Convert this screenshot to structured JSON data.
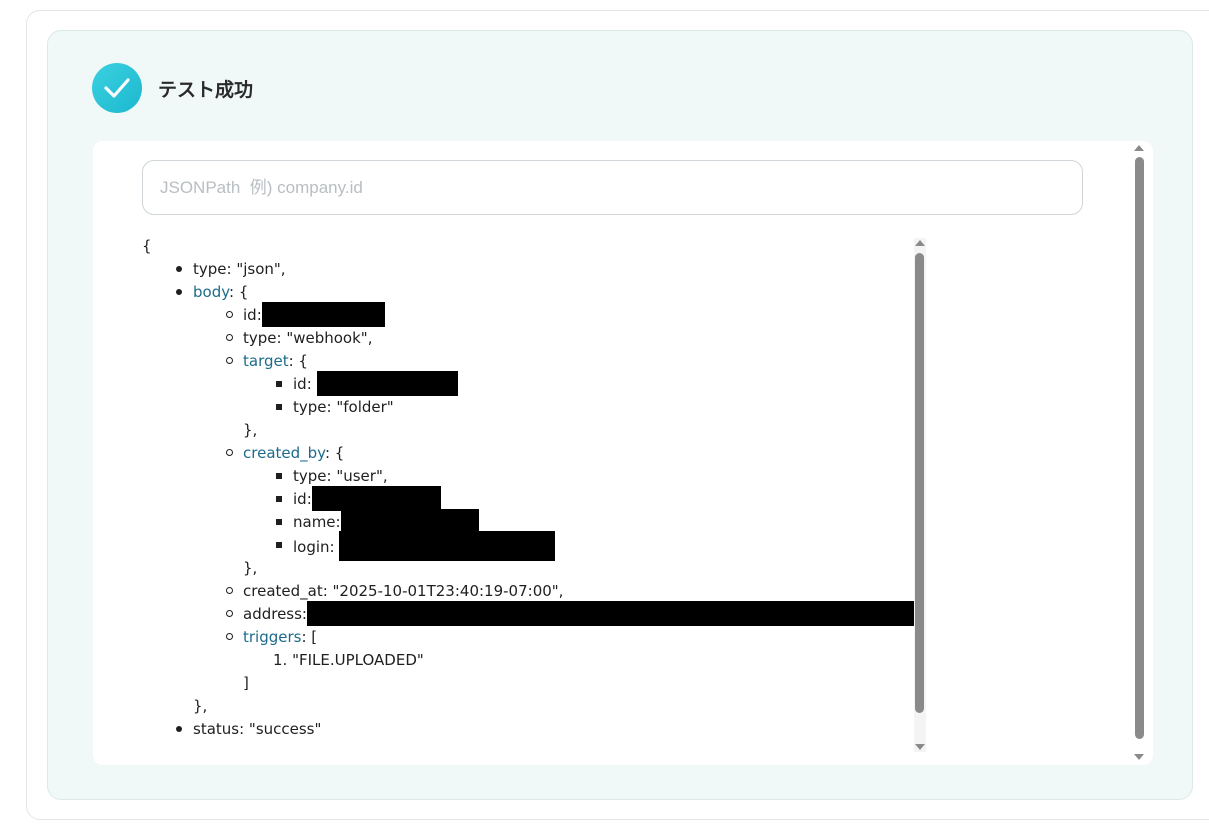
{
  "header": {
    "status_title": "テスト成功",
    "icon": "check-circle-icon",
    "accent_color": "#22c0d4"
  },
  "search": {
    "placeholder": "JSONPath  例) company.id",
    "value": ""
  },
  "tree": {
    "open_brace": "{",
    "type_line": "type: \"json\",",
    "body_key": "body",
    "body_open": ": {",
    "id_label": "id:",
    "webhook_type": "type: \"webhook\",",
    "target_key": "target",
    "target_open": ": {",
    "target_id_label": "id:",
    "target_type": "type: \"folder\"",
    "target_close": "},",
    "created_by_key": "created_by",
    "created_by_open": ": {",
    "user_type": "type: \"user\",",
    "user_id_label": "id:",
    "user_name_label": "name:",
    "user_login_label": "login:",
    "created_by_close": "},",
    "created_at": "created_at: \"2025-10-01T23:40:19-07:00\",",
    "address_label": "address:",
    "triggers_key": "triggers",
    "triggers_open": ": [",
    "trigger_index": "1.",
    "trigger_value": "\"FILE.UPLOADED\"",
    "triggers_close": "]",
    "body_close": "},",
    "status_line": "status: \"success\""
  }
}
